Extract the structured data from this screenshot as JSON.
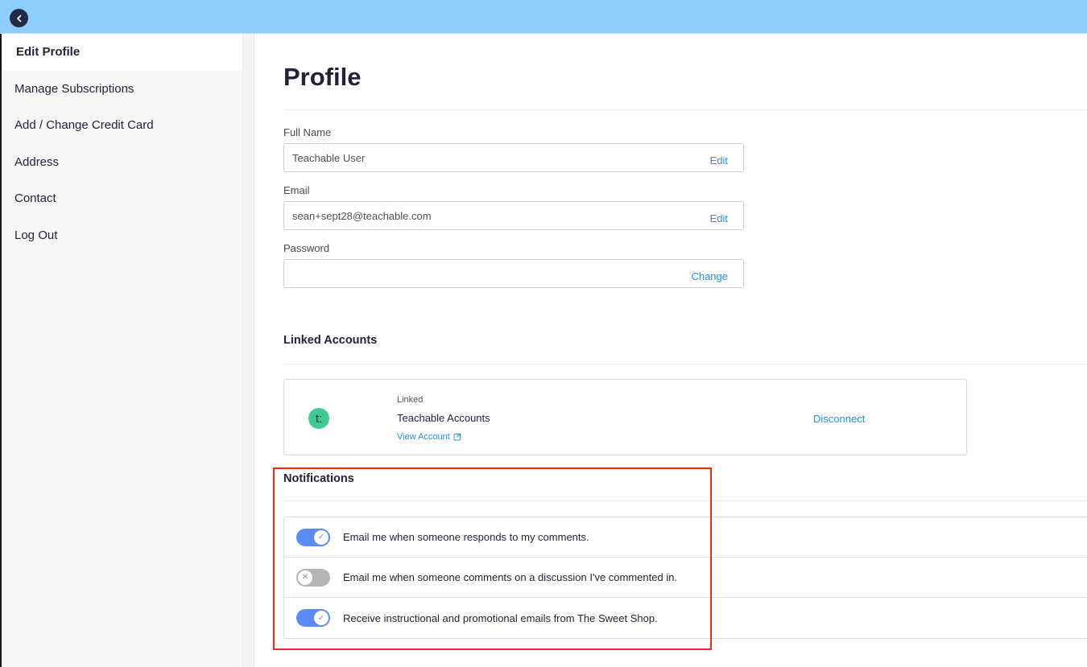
{
  "topbar": {
    "back_icon": "chevron-left-icon"
  },
  "sidebar": {
    "items": [
      {
        "label": "Edit Profile",
        "active": true
      },
      {
        "label": "Manage Subscriptions",
        "active": false
      },
      {
        "label": "Add / Change Credit Card",
        "active": false
      },
      {
        "label": "Address",
        "active": false
      },
      {
        "label": "Contact",
        "active": false
      },
      {
        "label": "Log Out",
        "active": false
      }
    ]
  },
  "main": {
    "title": "Profile",
    "fields": {
      "full_name": {
        "label": "Full Name",
        "value": "Teachable User",
        "action": "Edit"
      },
      "email": {
        "label": "Email",
        "value": "sean+sept28@teachable.com",
        "action": "Edit"
      },
      "password": {
        "label": "Password",
        "value": "",
        "action": "Change"
      }
    },
    "linked_accounts": {
      "title": "Linked Accounts",
      "account": {
        "logo_text": "t:",
        "logo_color": "#3fcb93",
        "status": "Linked",
        "name": "Teachable Accounts",
        "view_link": "View Account",
        "view_icon": "external-link-icon",
        "disconnect": "Disconnect"
      }
    },
    "notifications": {
      "title": "Notifications",
      "items": [
        {
          "label": "Email me when someone responds to my comments.",
          "enabled": true
        },
        {
          "label": "Email me when someone comments on a discussion I've commented in.",
          "enabled": false
        },
        {
          "label": "Receive instructional and promotional emails from The Sweet Shop.",
          "enabled": true
        }
      ]
    }
  },
  "colors": {
    "topbar": "#8ecefd",
    "link": "#1e94e8",
    "toggle_on": "#5b8cf7",
    "toggle_off": "#b5b5b5",
    "highlight": "#f02a16"
  }
}
